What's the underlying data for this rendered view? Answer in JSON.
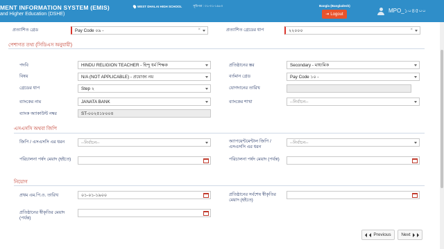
{
  "header": {
    "system_title": "MENT INFORMATION SYSTEM (EMIS)",
    "system_subtitle": "and Higher Education (DSHE)",
    "school": "WEST DHALAI HIGH SCHOOL",
    "date_label": "সূচিপত্র : ০১-০১-১৯৮০",
    "language": "Bangla (Bangladesh)",
    "logout_label": "Logout",
    "user": "MPO_১০৪৫০০"
  },
  "top_row": {
    "approved_grade_label": "প্রত্যাশিত গ্রেড",
    "approved_grade_value": "Pay Code ০৯ -",
    "approved_grade_step_label": "প্রত্যাশিত গ্রেডের ধাপ",
    "approved_grade_step_value": "২২০০০"
  },
  "section_professional": {
    "title": "পেশাগত তথ্য (সিডিএস অনুযায়ী)",
    "designation_label": "পদবি",
    "designation_value": "HINDU RELIGION TEACHER - হিন্দু ধর্ম শিক্ষক",
    "level_label": "প্রতিষ্ঠানের স্তর",
    "level_value": "Secondary - মাধ্যমিক",
    "subject_label": "বিষয়",
    "subject_value": "N/A (NOT APPLICABLE) - প্রযোজ্য নয়",
    "current_grade_label": "বর্তমান গ্রেড",
    "current_grade_value": "Pay Code ১০ -",
    "grade_step_label": "গ্রেডের ধাপ",
    "grade_step_value": "Step ২",
    "join_date_label": "যোগদানের তারিখ",
    "join_date_value": "",
    "bank_name_label": "ব্যাংকের নাম",
    "bank_name_value": "JANATA BANK",
    "bank_branch_label": "ব্যাংকের শাখা",
    "bank_branch_value": "--নির্বাচন--",
    "account_label": "ব্যাংক অ্যাকাউন্ট নম্বর",
    "account_value": "ST-০০২৫১৮০০৪"
  },
  "section_ssc": {
    "title": "এসএসসি অথবা জিপি",
    "gpa_label": "জিপি / এসএসসি এর ধরন",
    "gpa_value": "--নির্বাচন--",
    "appointment_label": "অ্যাপয়েন্টমেন্টাল জিপি / এসএসসি এর ধরন",
    "appointment_value": "--নির্বাচন--",
    "probation_from_label": "পরিচালনা পর্ষদ মেয়াদ (হইতে)",
    "probation_from_value": "",
    "probation_to_label": "পরিচালনা পর্ষদ মেয়াদ (পর্যন্ত)",
    "probation_to_value": ""
  },
  "section_appointment": {
    "title": "নিয়োগ",
    "first_mpo_label": "প্রথম এম.পি.ও. তারিখ",
    "first_mpo_value": "০১-০১-১৯০০",
    "recognition_from_label": "প্রতিষ্ঠানের সর্বশেষ স্বীকৃতির মেয়াদ (হইতে)",
    "recognition_from_value": "",
    "recognition_to_label": "প্রতিষ্ঠানের স্বীকৃতির মেয়াদ (পর্যন্ত)",
    "recognition_to_value": ""
  },
  "buttons": {
    "previous": "Previous",
    "next": "Next"
  },
  "colors": {
    "header_bg": "#2f8ec9",
    "logout_bg": "#e8532c",
    "required_marker": "#d9342b",
    "section_title": "#c0392b"
  }
}
